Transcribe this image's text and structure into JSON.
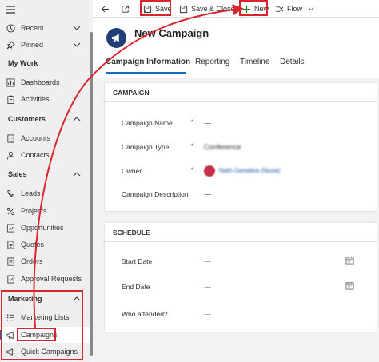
{
  "sidebar": {
    "top_items": [
      {
        "label": "Recent",
        "icon": "clock-icon"
      },
      {
        "label": "Pinned",
        "icon": "pin-icon"
      }
    ],
    "groups": [
      {
        "title": "My Work",
        "items": [
          {
            "label": "Dashboards",
            "icon": "dashboard-icon"
          },
          {
            "label": "Activities",
            "icon": "clipboard-icon"
          }
        ]
      },
      {
        "title": "Customers",
        "items": [
          {
            "label": "Accounts",
            "icon": "building-icon"
          },
          {
            "label": "Contacts",
            "icon": "person-icon"
          }
        ]
      },
      {
        "title": "Sales",
        "items": [
          {
            "label": "Leads",
            "icon": "phone-icon"
          },
          {
            "label": "Projects",
            "icon": "percent-icon"
          },
          {
            "label": "Opportunities",
            "icon": "opportunity-icon"
          },
          {
            "label": "Quotes",
            "icon": "quote-icon"
          },
          {
            "label": "Orders",
            "icon": "order-icon"
          },
          {
            "label": "Approval Requests",
            "icon": "approval-icon"
          }
        ]
      },
      {
        "title": "Marketing",
        "items": [
          {
            "label": "Marketing Lists",
            "icon": "list-icon"
          },
          {
            "label": "Campaigns",
            "icon": "megaphone-icon",
            "selected": true
          },
          {
            "label": "Quick Campaigns",
            "icon": "quick-campaign-icon"
          }
        ]
      }
    ]
  },
  "toolbar": {
    "save_label": "Save",
    "save_close_label": "Save & Close",
    "new_label": "New",
    "flow_label": "Flow"
  },
  "header": {
    "title": "New Campaign",
    "tabs": [
      "Campaign Information",
      "Reporting",
      "Timeline",
      "Details"
    ],
    "active_tab": "Campaign Information"
  },
  "campaign_section": {
    "title": "CAMPAIGN",
    "fields": [
      {
        "label": "Campaign Name",
        "required": true,
        "value": "---"
      },
      {
        "label": "Campaign Type",
        "required": true,
        "value": "Conference"
      },
      {
        "label": "Owner",
        "required": true,
        "value": "Nath Genebra (Nusa)"
      },
      {
        "label": "Campaign Description",
        "required": false,
        "value": "---"
      }
    ]
  },
  "schedule_section": {
    "title": "SCHEDULE",
    "fields": [
      {
        "label": "Start Date",
        "value": "---"
      },
      {
        "label": "End Date",
        "value": "---"
      },
      {
        "label": "Who attended?",
        "value": "---"
      }
    ]
  },
  "colors": {
    "annotation_red": "#d9262e",
    "brand_blue": "#0f6cbd",
    "entity_icon_bg": "#1f3f75",
    "required_red": "#a4262c"
  }
}
